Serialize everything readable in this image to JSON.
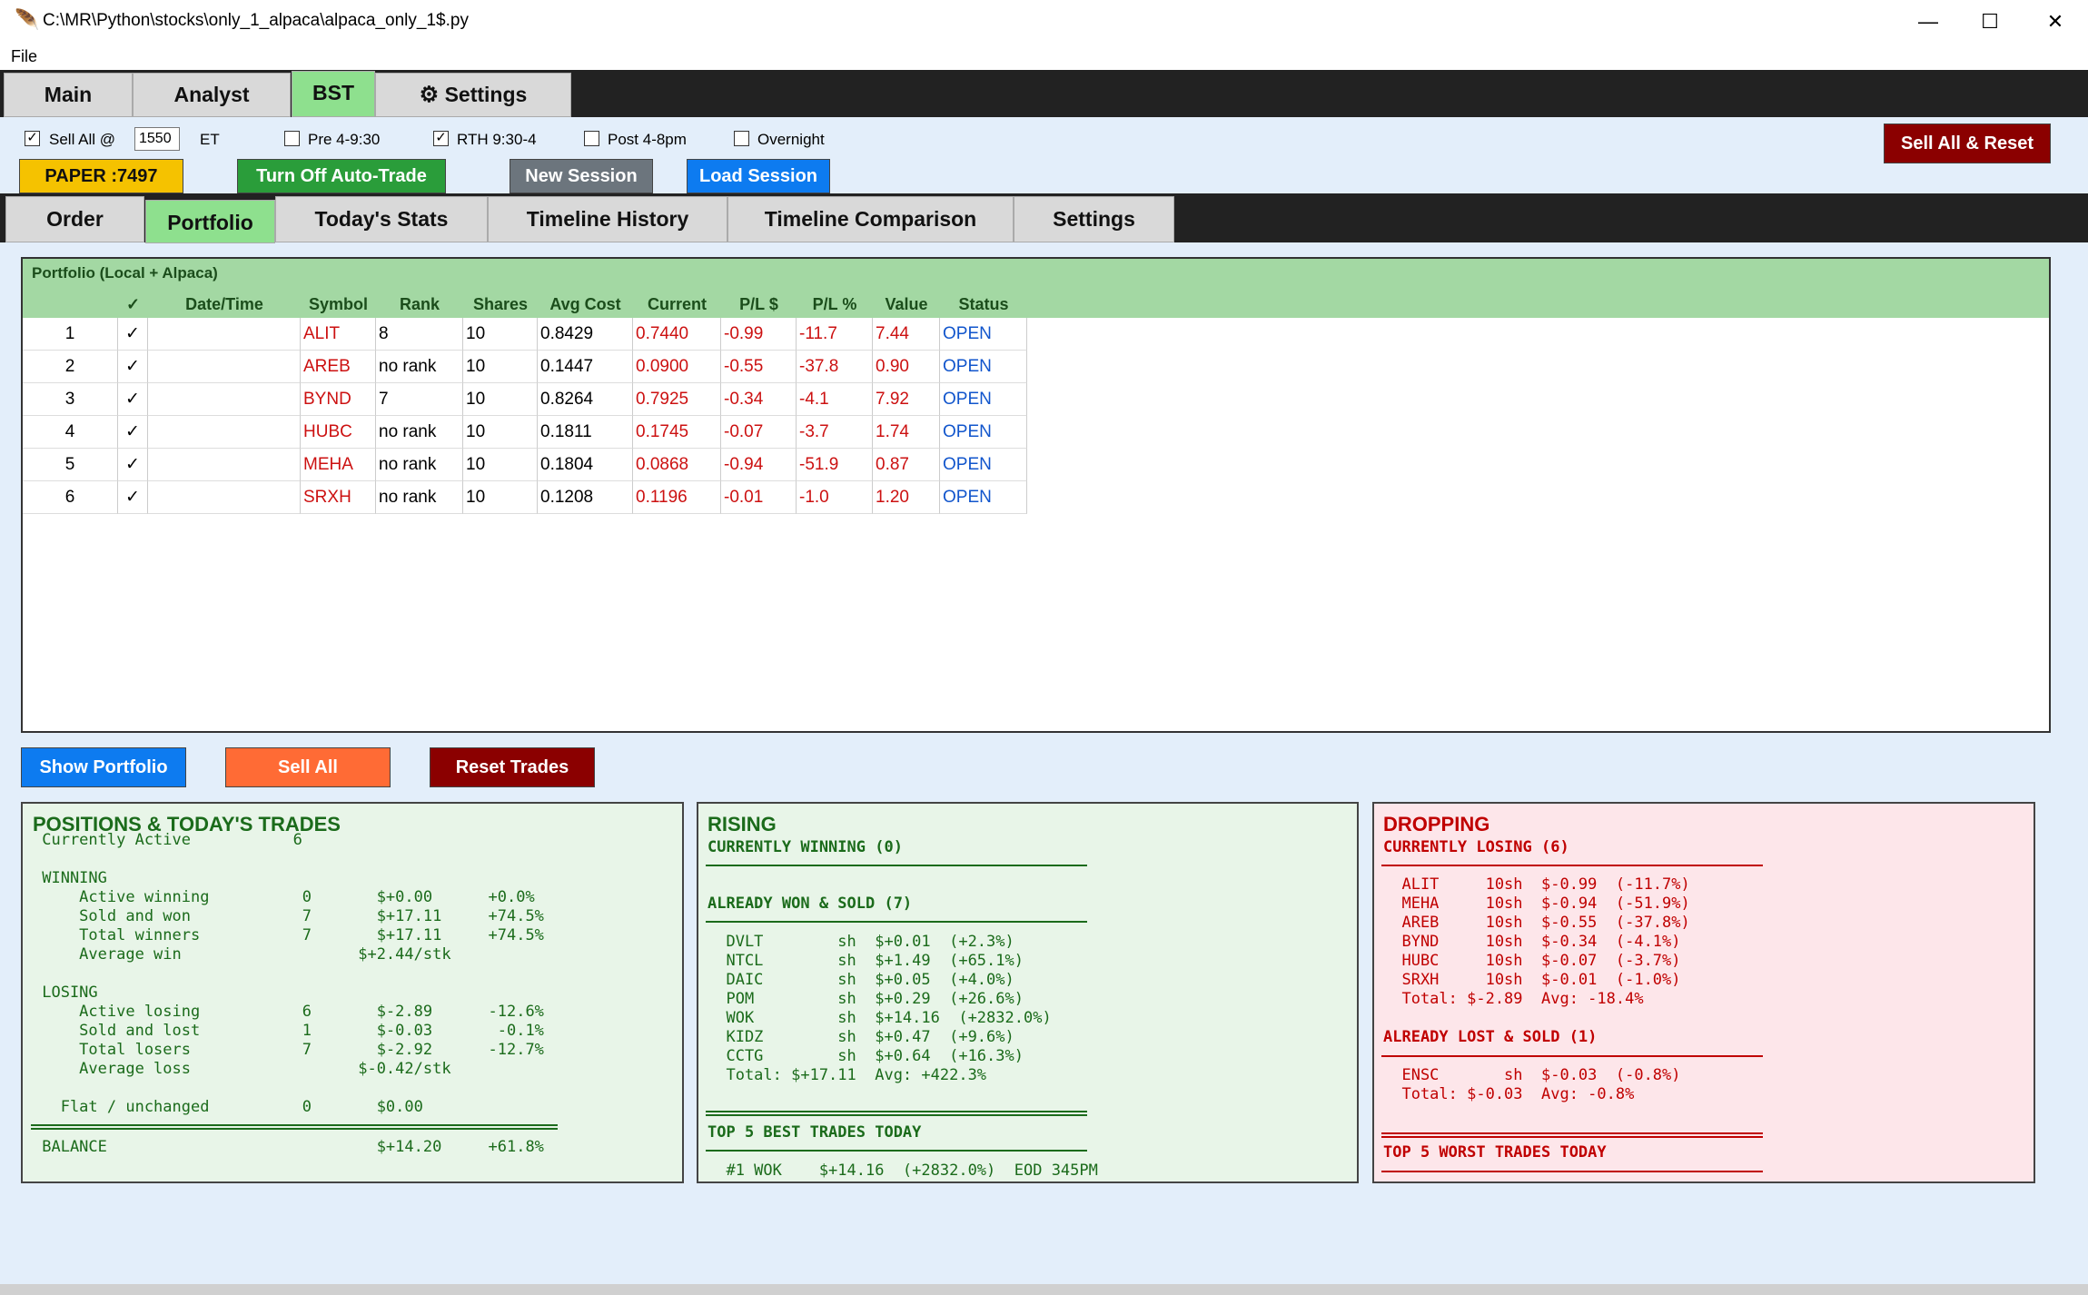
{
  "window": {
    "title": "C:\\MR\\Python\\stocks\\only_1_alpaca\\alpaca_only_1$.py",
    "min": "—",
    "max": "☐",
    "close": "✕"
  },
  "menu": {
    "file": "File"
  },
  "top_tabs": [
    "Main",
    "Analyst",
    "BST",
    "Settings"
  ],
  "controls": {
    "sell_all_label": "Sell All @",
    "sell_all_checked": true,
    "sell_all_time": "1550",
    "et_label": "ET",
    "pre_label": "Pre 4-9:30",
    "pre_checked": false,
    "rth_label": "RTH 9:30-4",
    "rth_checked": true,
    "post_label": "Post 4-8pm",
    "post_checked": false,
    "overnight_label": "Overnight",
    "overnight_checked": false,
    "sell_all_reset": "Sell All & Reset",
    "paper": "PAPER :7497",
    "auto_trade": "Turn Off Auto-Trade",
    "new_session": "New Session",
    "load_session": "Load Session"
  },
  "sub_tabs": [
    "Order",
    "Portfolio",
    "Today's Stats",
    "Timeline History",
    "Timeline Comparison",
    "Settings"
  ],
  "portfolio": {
    "title": "Portfolio (Local + Alpaca)",
    "columns": [
      "",
      "✓",
      "Date/Time",
      "Symbol",
      "Rank",
      "Shares",
      "Avg Cost",
      "Current",
      "P/L $",
      "P/L %",
      "Value",
      "Status"
    ],
    "rows": [
      [
        "1",
        "✓",
        "",
        "ALIT",
        "8",
        "10",
        "0.8429",
        "0.7440",
        "-0.99",
        "-11.7",
        "7.44",
        "OPEN"
      ],
      [
        "2",
        "✓",
        "",
        "AREB",
        "no rank",
        "10",
        "0.1447",
        "0.0900",
        "-0.55",
        "-37.8",
        "0.90",
        "OPEN"
      ],
      [
        "3",
        "✓",
        "",
        "BYND",
        "7",
        "10",
        "0.8264",
        "0.7925",
        "-0.34",
        "-4.1",
        "7.92",
        "OPEN"
      ],
      [
        "4",
        "✓",
        "",
        "HUBC",
        "no rank",
        "10",
        "0.1811",
        "0.1745",
        "-0.07",
        "-3.7",
        "1.74",
        "OPEN"
      ],
      [
        "5",
        "✓",
        "",
        "MEHA",
        "no rank",
        "10",
        "0.1804",
        "0.0868",
        "-0.94",
        "-51.9",
        "0.87",
        "OPEN"
      ],
      [
        "6",
        "✓",
        "",
        "SRXH",
        "no rank",
        "10",
        "0.1208",
        "0.1196",
        "-0.01",
        "-1.0",
        "1.20",
        "OPEN"
      ]
    ]
  },
  "actions": {
    "show_portfolio": "Show Portfolio",
    "sell_all": "Sell All",
    "reset_trades": "Reset Trades"
  },
  "positions_panel": {
    "title": "POSITIONS & TODAY'S TRADES",
    "lines": [
      " Currently Active           6",
      "",
      " WINNING",
      "     Active winning          0       $+0.00      +0.0%",
      "     Sold and won            7       $+17.11     +74.5%",
      "     Total winners           7       $+17.11     +74.5%",
      "     Average win                   $+2.44/stk",
      "",
      " LOSING",
      "     Active losing           6       $-2.89      -12.6%",
      "     Sold and lost           1       $-0.03       -0.1%",
      "     Total losers            7       $-2.92      -12.7%",
      "     Average loss                  $-0.42/stk",
      "",
      "   Flat / unchanged          0       $0.00"
    ],
    "balance": " BALANCE                             $+14.20     +61.8%"
  },
  "rising_panel": {
    "title": "RISING",
    "currently_winning": "CURRENTLY WINNING (0)",
    "already_won": "ALREADY WON & SOLD (7)",
    "won_lines": [
      "  DVLT        sh  $+0.01  (+2.3%)",
      "  NTCL        sh  $+1.49  (+65.1%)",
      "  DAIC        sh  $+0.05  (+4.0%)",
      "  POM         sh  $+0.29  (+26.6%)",
      "  WOK         sh  $+14.16  (+2832.0%)",
      "  KIDZ        sh  $+0.47  (+9.6%)",
      "  CCTG        sh  $+0.64  (+16.3%)",
      "  Total: $+17.11  Avg: +422.3%"
    ],
    "top5": "TOP 5 BEST TRADES TODAY",
    "top5_lines": [
      "  #1 WOK    $+14.16  (+2832.0%)  EOD 345PM"
    ]
  },
  "dropping_panel": {
    "title": "DROPPING",
    "currently_losing": "CURRENTLY LOSING (6)",
    "losing_lines": [
      "  ALIT     10sh  $-0.99  (-11.7%)",
      "  MEHA     10sh  $-0.94  (-51.9%)",
      "  AREB     10sh  $-0.55  (-37.8%)",
      "  BYND     10sh  $-0.34  (-4.1%)",
      "  HUBC     10sh  $-0.07  (-3.7%)",
      "  SRXH     10sh  $-0.01  (-1.0%)",
      "  Total: $-2.89  Avg: -18.4%"
    ],
    "already_lost": "ALREADY LOST & SOLD (1)",
    "lost_lines": [
      "  ENSC       sh  $-0.03  (-0.8%)",
      "  Total: $-0.03  Avg: -0.8%"
    ],
    "top5": "TOP 5 WORST TRADES TODAY"
  },
  "colors": {
    "accent_green": "#8ee08e",
    "loss_red": "#cc1111",
    "open_blue": "#1155cc",
    "dark_red": "#7a0000"
  }
}
